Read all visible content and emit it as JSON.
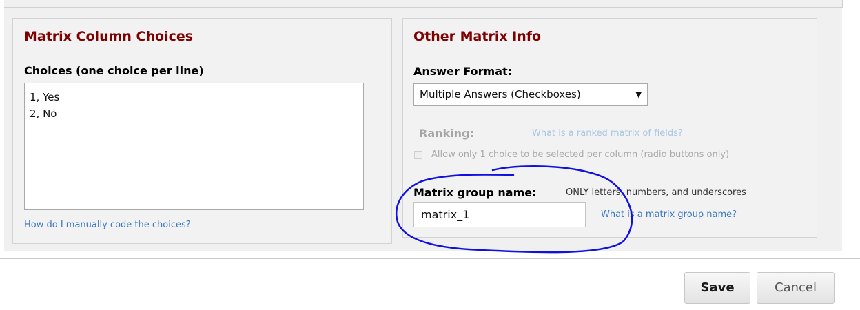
{
  "left_panel": {
    "title": "Matrix Column Choices",
    "choices_label": "Choices (one choice per line)",
    "choices": [
      "1, Yes",
      "2, No"
    ],
    "help_link": "How do I manually code the choices?"
  },
  "right_panel": {
    "title": "Other Matrix Info",
    "answer_format_label": "Answer Format:",
    "answer_format_value": "Multiple Answers (Checkboxes)",
    "ranking_label": "Ranking:",
    "ranking_link": "What is a ranked matrix of fields?",
    "ranking_checkbox_label": "Allow only 1 choice to be selected per column (radio buttons only)",
    "group_name_label": "Matrix group name:",
    "group_name_hint": "ONLY letters, numbers, and underscores",
    "group_name_value": "matrix_1",
    "group_name_link": "What is a matrix group name?"
  },
  "buttons": {
    "save": "Save",
    "cancel": "Cancel"
  },
  "icons": {
    "select_arrow": "dropdown-triangle-icon"
  },
  "colors": {
    "title": "#800000",
    "link": "#3a78c0",
    "annotation": "#1010e0"
  }
}
